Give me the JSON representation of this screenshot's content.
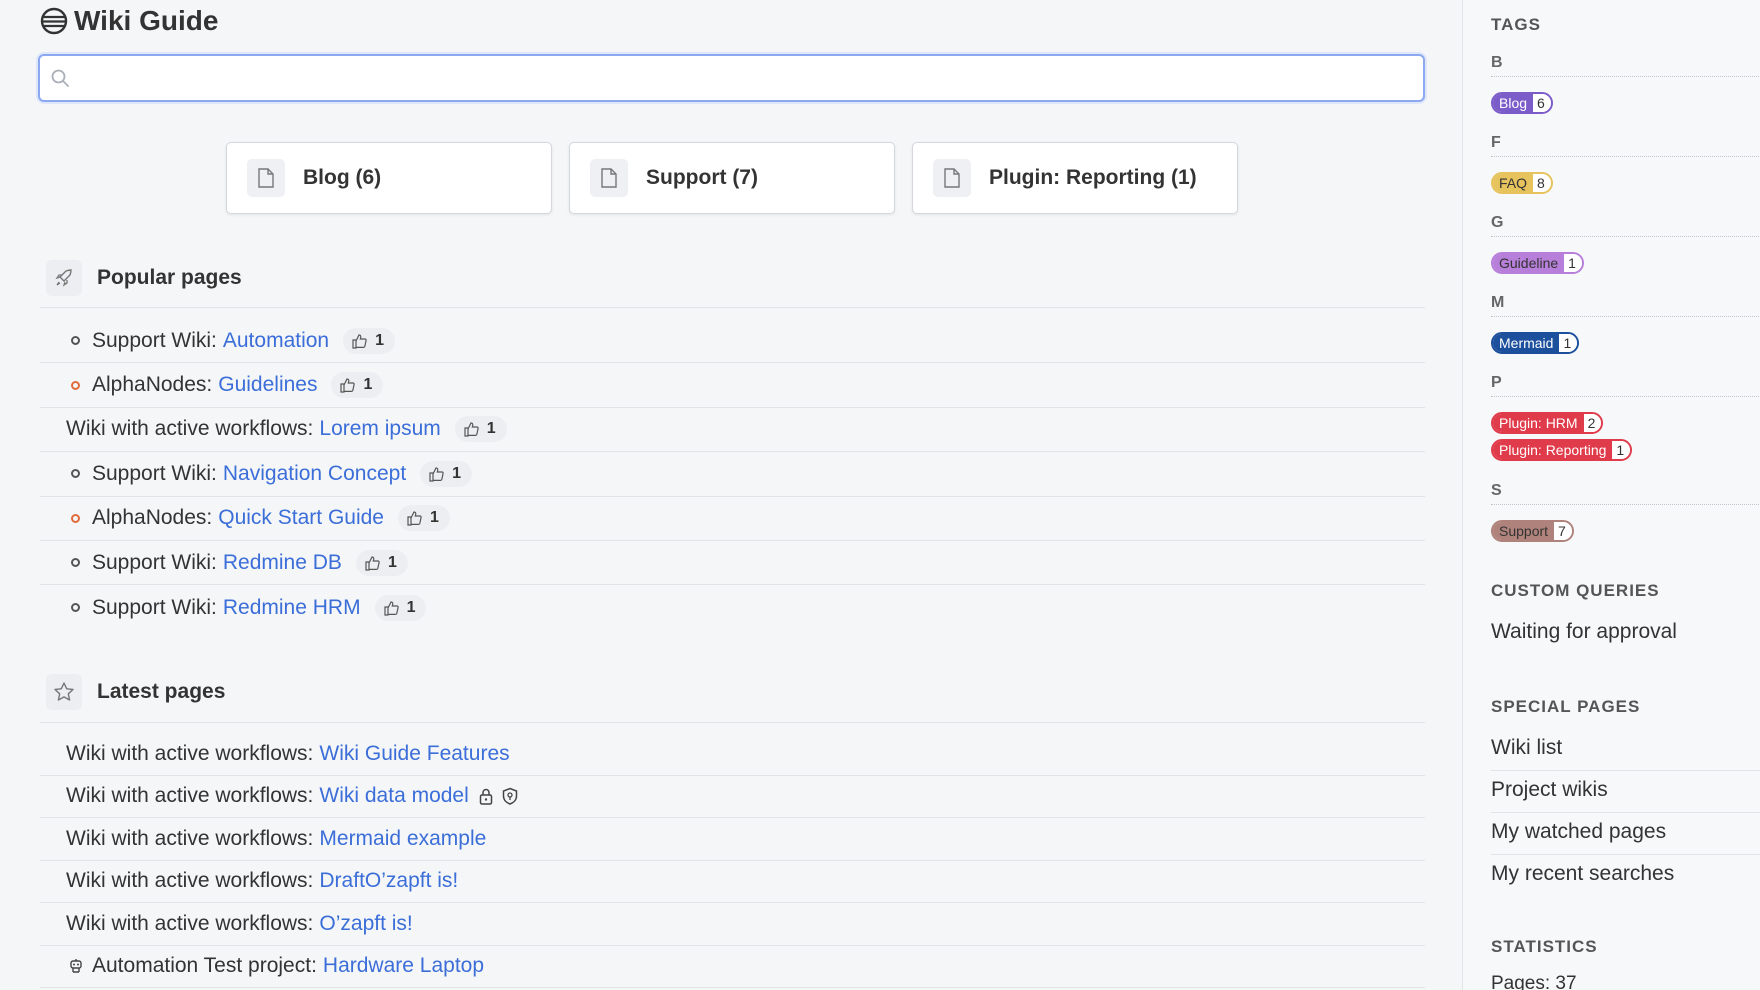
{
  "header": {
    "title": "Wiki Guide"
  },
  "search": {
    "placeholder": ""
  },
  "cards": [
    {
      "label": "Blog (6)"
    },
    {
      "label": "Support (7)"
    },
    {
      "label": "Plugin: Reporting (1)"
    }
  ],
  "popular": {
    "title": "Popular pages",
    "items": [
      {
        "prefix": "Support Wiki:",
        "link": "Automation",
        "likes": "1",
        "bullet": "dark"
      },
      {
        "prefix": "AlphaNodes:",
        "link": "Guidelines",
        "likes": "1",
        "bullet": "orange"
      },
      {
        "prefix": "Wiki with active workflows:",
        "link": "Lorem ipsum",
        "likes": "1",
        "bullet": "none"
      },
      {
        "prefix": "Support Wiki:",
        "link": "Navigation Concept",
        "likes": "1",
        "bullet": "dark"
      },
      {
        "prefix": "AlphaNodes:",
        "link": "Quick Start Guide",
        "likes": "1",
        "bullet": "orange"
      },
      {
        "prefix": "Support Wiki:",
        "link": "Redmine DB",
        "likes": "1",
        "bullet": "dark"
      },
      {
        "prefix": "Support Wiki:",
        "link": "Redmine HRM",
        "likes": "1",
        "bullet": "dark"
      }
    ]
  },
  "latest": {
    "title": "Latest pages",
    "items": [
      {
        "prefix": "Wiki with active workflows:",
        "link": "Wiki Guide Features"
      },
      {
        "prefix": "Wiki with active workflows:",
        "link": "Wiki data model",
        "icons": [
          "lock-icon",
          "shield-icon"
        ]
      },
      {
        "prefix": "Wiki with active workflows:",
        "link": "Mermaid example"
      },
      {
        "prefix": "Wiki with active workflows:",
        "link": "DraftO’zapft is!"
      },
      {
        "prefix": "Wiki with active workflows:",
        "link": "O’zapft is!"
      },
      {
        "prefix": "Automation Test project:",
        "link": "Hardware Laptop",
        "icons": [
          "robot-icon"
        ]
      }
    ]
  },
  "sidebar": {
    "tags_title": "TAGS",
    "tag_groups": [
      {
        "letter": "B",
        "tags": [
          {
            "name": "Blog",
            "count": "6",
            "color": "#7b5cc9"
          }
        ]
      },
      {
        "letter": "F",
        "tags": [
          {
            "name": "FAQ",
            "count": "8",
            "color": "#e6c35c"
          }
        ]
      },
      {
        "letter": "G",
        "tags": [
          {
            "name": "Guideline",
            "count": "1",
            "color": "#b77fd9"
          }
        ]
      },
      {
        "letter": "M",
        "tags": [
          {
            "name": "Mermaid",
            "count": "1",
            "color": "#1c4f9c"
          }
        ]
      },
      {
        "letter": "P",
        "tags": [
          {
            "name": "Plugin: HRM",
            "count": "2",
            "color": "#e03b4a"
          },
          {
            "name": "Plugin: Reporting",
            "count": "1",
            "color": "#e03b4a"
          }
        ]
      },
      {
        "letter": "S",
        "tags": [
          {
            "name": "Support",
            "count": "7",
            "color": "#b0827c"
          }
        ]
      }
    ],
    "custom_queries_title": "CUSTOM QUERIES",
    "custom_queries": [
      "Waiting for approval"
    ],
    "special_pages_title": "SPECIAL PAGES",
    "special_pages": [
      "Wiki list",
      "Project wikis",
      "My watched pages",
      "My recent searches"
    ],
    "statistics_title": "STATISTICS",
    "statistics_pages": "Pages: 37"
  },
  "colors": {
    "link": "#3b6ed8",
    "search_border": "#8ca8f0",
    "bullet_orange": "#e06c3c"
  }
}
